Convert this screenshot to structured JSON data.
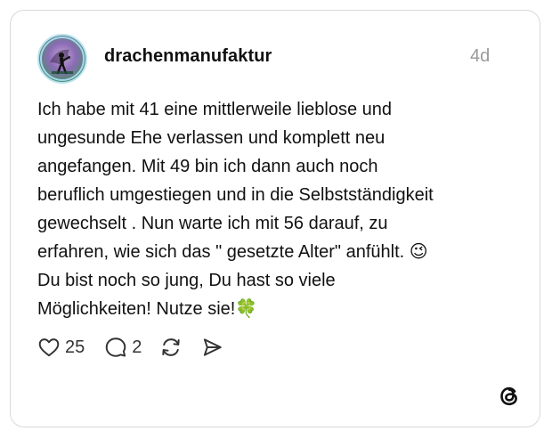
{
  "post": {
    "username": "drachenmanufaktur",
    "time": "4d",
    "text": "Ich habe mit 41 eine mittlerweile lieblose und\nungesunde Ehe verlassen und komplett neu\nangefangen. Mit 49 bin ich dann auch noch\nberuflich umgestiegen und in die Selbstständigkeit\ngewechselt . Nun warte ich  mit 56 darauf, zu\nerfahren, wie sich das \" gesetzte Alter\" anfühlt. 😉\nDu bist noch so jung, Du hast so viele\nMöglichkeiten! Nutze sie!🍀",
    "like_count": "25",
    "reply_count": "2"
  },
  "icons": {
    "like": "heart-icon",
    "reply": "comment-icon",
    "repost": "repost-icon",
    "share": "send-icon",
    "brand": "threads-logo-icon"
  },
  "colors": {
    "text": "#111111",
    "muted": "#999999",
    "border": "#d9d9d9"
  }
}
